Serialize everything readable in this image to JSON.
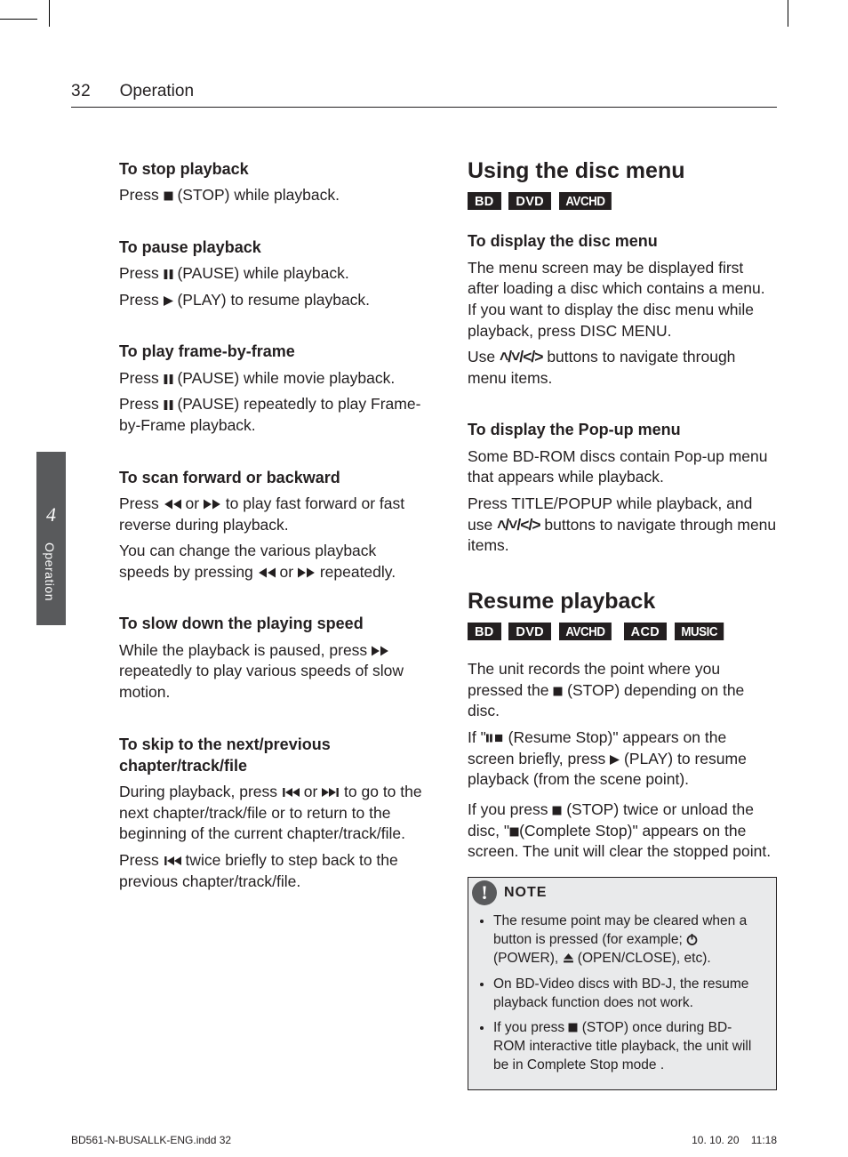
{
  "page_number": "32",
  "section_title": "Operation",
  "sidetab": {
    "number": "4",
    "label": "Operation"
  },
  "left": {
    "stop": {
      "title": "To stop playback",
      "p1a": "Press ",
      "p1b": " (STOP) while playback."
    },
    "pause": {
      "title": "To pause playback",
      "p1a": "Press ",
      "p1b": " (PAUSE) while playback.",
      "p2a": "Press ",
      "p2b": " (PLAY) to resume playback."
    },
    "frame": {
      "title": "To play frame-by-frame",
      "p1a": "Press ",
      "p1b": " (PAUSE) while movie playback.",
      "p2a": "Press ",
      "p2b": " (PAUSE) repeatedly to play Frame-by-Frame playback."
    },
    "scan": {
      "title": "To scan forward or backward",
      "p1a": "Press ",
      "p1b": " or ",
      "p1c": " to play fast forward or fast reverse during playback.",
      "p2a": "You can change the various playback speeds by pressing ",
      "p2b": " or ",
      "p2c": " repeatedly."
    },
    "slow": {
      "title": "To slow down the playing speed",
      "p1a": "While the playback is paused, press ",
      "p1b": " repeatedly to play various speeds of slow motion."
    },
    "skip": {
      "title": "To skip to the next/previous chapter/track/file",
      "p1a": "During playback, press ",
      "p1b": " or ",
      "p1c": " to go to the next chapter/track/file or to return to the beginning of the current chapter/track/file.",
      "p2a": "Press ",
      "p2b": " twice briefly to step back to the previous chapter/track/file."
    }
  },
  "right": {
    "discmenu": {
      "heading": "Using the disc menu",
      "badges": [
        "BD",
        "DVD",
        "AVCHD"
      ],
      "disp_title": "To display the disc menu",
      "disp_p1": "The menu screen may be displayed first after loading a disc which contains a menu. If you want to display the disc menu while playback, press DISC MENU.",
      "disp_p2a": "Use ",
      "disp_p2b": " buttons to navigate through menu items.",
      "popup_title": "To display the Pop-up menu",
      "popup_p1": "Some BD-ROM discs contain Pop-up menu that appears while playback.",
      "popup_p2a": "Press TITLE/POPUP while playback, and use ",
      "popup_p2b": " buttons to navigate through menu items."
    },
    "resume": {
      "heading": "Resume playback",
      "badges": [
        "BD",
        "DVD",
        "AVCHD",
        "ACD",
        "MUSIC"
      ],
      "p1a": "The unit records the point where you pressed the ",
      "p1b": " (STOP) depending on the disc.",
      "p2a": "If \"",
      "p2b": " (Resume Stop)\" appears on the screen briefly, press ",
      "p2c": " (PLAY)  to resume playback (from the scene point).",
      "p3a": "If you press ",
      "p3b": " (STOP) twice or unload the disc, \"",
      "p3c": "(Complete Stop)\" appears on the screen. The unit will clear the stopped point."
    },
    "note": {
      "title": "NOTE",
      "li1a": "The resume point may be cleared when a button is pressed (for example; ",
      "li1b": " (POWER), ",
      "li1c": " (OPEN/CLOSE), etc).",
      "li2": "On BD-Video discs with BD-J, the resume playback function does not work.",
      "li3a": "If you press ",
      "li3b": " (STOP) once during BD-ROM interactive title playback, the unit will be in Complete Stop mode ."
    }
  },
  "nav_glyph": "U/u/I/i",
  "footer": {
    "file": "BD561-N-BUSALLK-ENG.indd   32",
    "date": "10. 10. 20",
    "time": "11:18"
  }
}
